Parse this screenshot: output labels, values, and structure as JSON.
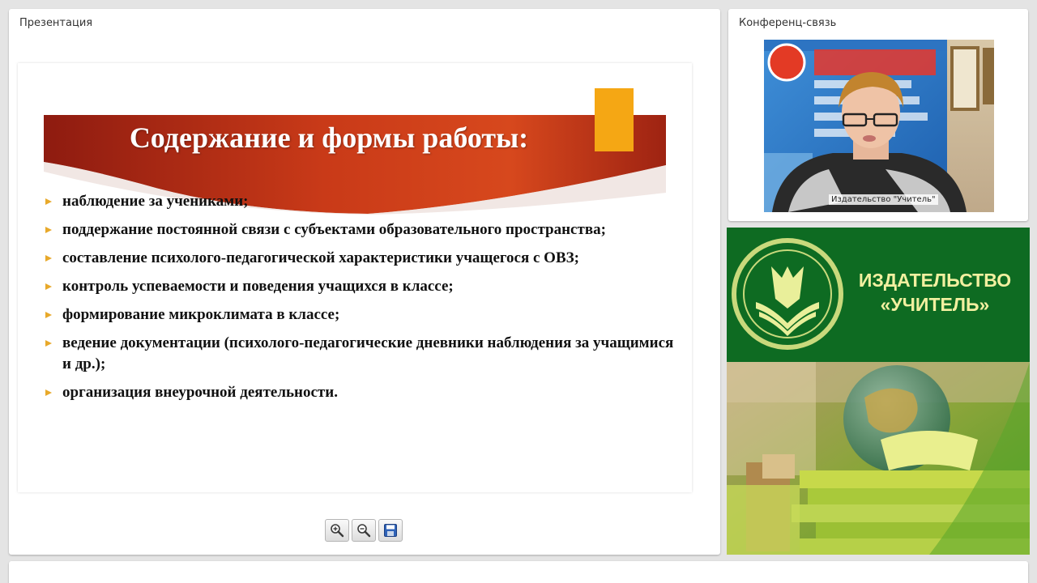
{
  "presentation": {
    "panel_title": "Презентация",
    "slide": {
      "title": "Содержание и формы работы:",
      "items": [
        "наблюдение за учениками;",
        "поддержание постоянной связи с субъектами образовательного пространства;",
        "составление психолого-педагогической характеристики учащегося с ОВЗ;",
        "контроль успеваемости и поведения учащихся в классе;",
        "формирование микроклимата в классе;",
        "ведение документации (психолого-педагогические дневники наблюдения за учащимися и др.);",
        "организация внеурочной деятельности."
      ]
    },
    "toolbar": {
      "zoom_in_icon": "zoom-in-icon",
      "zoom_out_icon": "zoom-out-icon",
      "save_icon": "save-icon"
    }
  },
  "conference": {
    "panel_title": "Конференц-связь",
    "video_label": "Издательство \"Учитель\""
  },
  "publisher": {
    "name_line1": "ИЗДАТЕЛЬСТВО",
    "name_line2": "«УЧИТЕЛЬ»"
  },
  "colors": {
    "banner_red": "#b8291a",
    "accent_orange": "#f5a714",
    "bullet_gold": "#e8a92a",
    "publisher_green": "#0e6b22",
    "publisher_text": "#f2f0a0"
  }
}
